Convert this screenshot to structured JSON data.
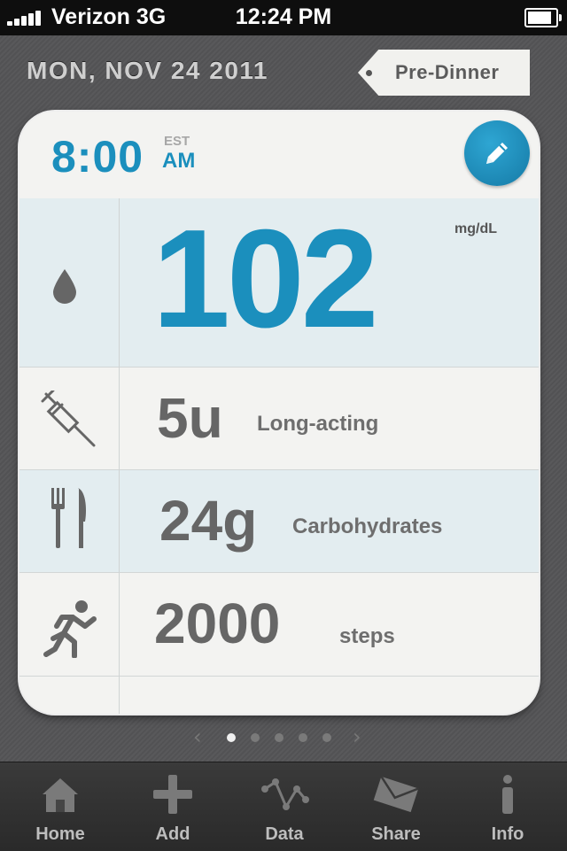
{
  "status_bar": {
    "carrier": "Verizon",
    "network": "3G",
    "time": "12:24 PM",
    "battery_level": 1.0,
    "signal_bars": 5
  },
  "header": {
    "date": "MON, NOV 24 2011",
    "tag_label": "Pre-Dinner"
  },
  "entry": {
    "time": "8:00",
    "timezone": "EST",
    "ampm": "AM",
    "edit_icon": "pencil-icon",
    "glucose": {
      "icon": "drop-icon",
      "value": "102",
      "unit": "mg/dL"
    },
    "insulin": {
      "icon": "syringe-icon",
      "value": "5u",
      "label": "Long-acting"
    },
    "carbs": {
      "icon": "fork-knife-icon",
      "value": "24g",
      "label": "Carbohydrates"
    },
    "activity": {
      "icon": "runner-icon",
      "value": "2000",
      "label": "steps"
    }
  },
  "pager": {
    "prev": "‹",
    "next": "›",
    "pages": 5,
    "current": 1
  },
  "colors": {
    "accent": "#1b8fbd",
    "card": "#f3f3f1",
    "row_highlight": "#e3edf0",
    "background": "#555557"
  },
  "tabbar": {
    "items": [
      {
        "label": "Home",
        "icon": "home-icon"
      },
      {
        "label": "Add",
        "icon": "plus-icon"
      },
      {
        "label": "Data",
        "icon": "chart-icon"
      },
      {
        "label": "Share",
        "icon": "envelope-icon"
      },
      {
        "label": "Info",
        "icon": "info-icon"
      }
    ]
  }
}
